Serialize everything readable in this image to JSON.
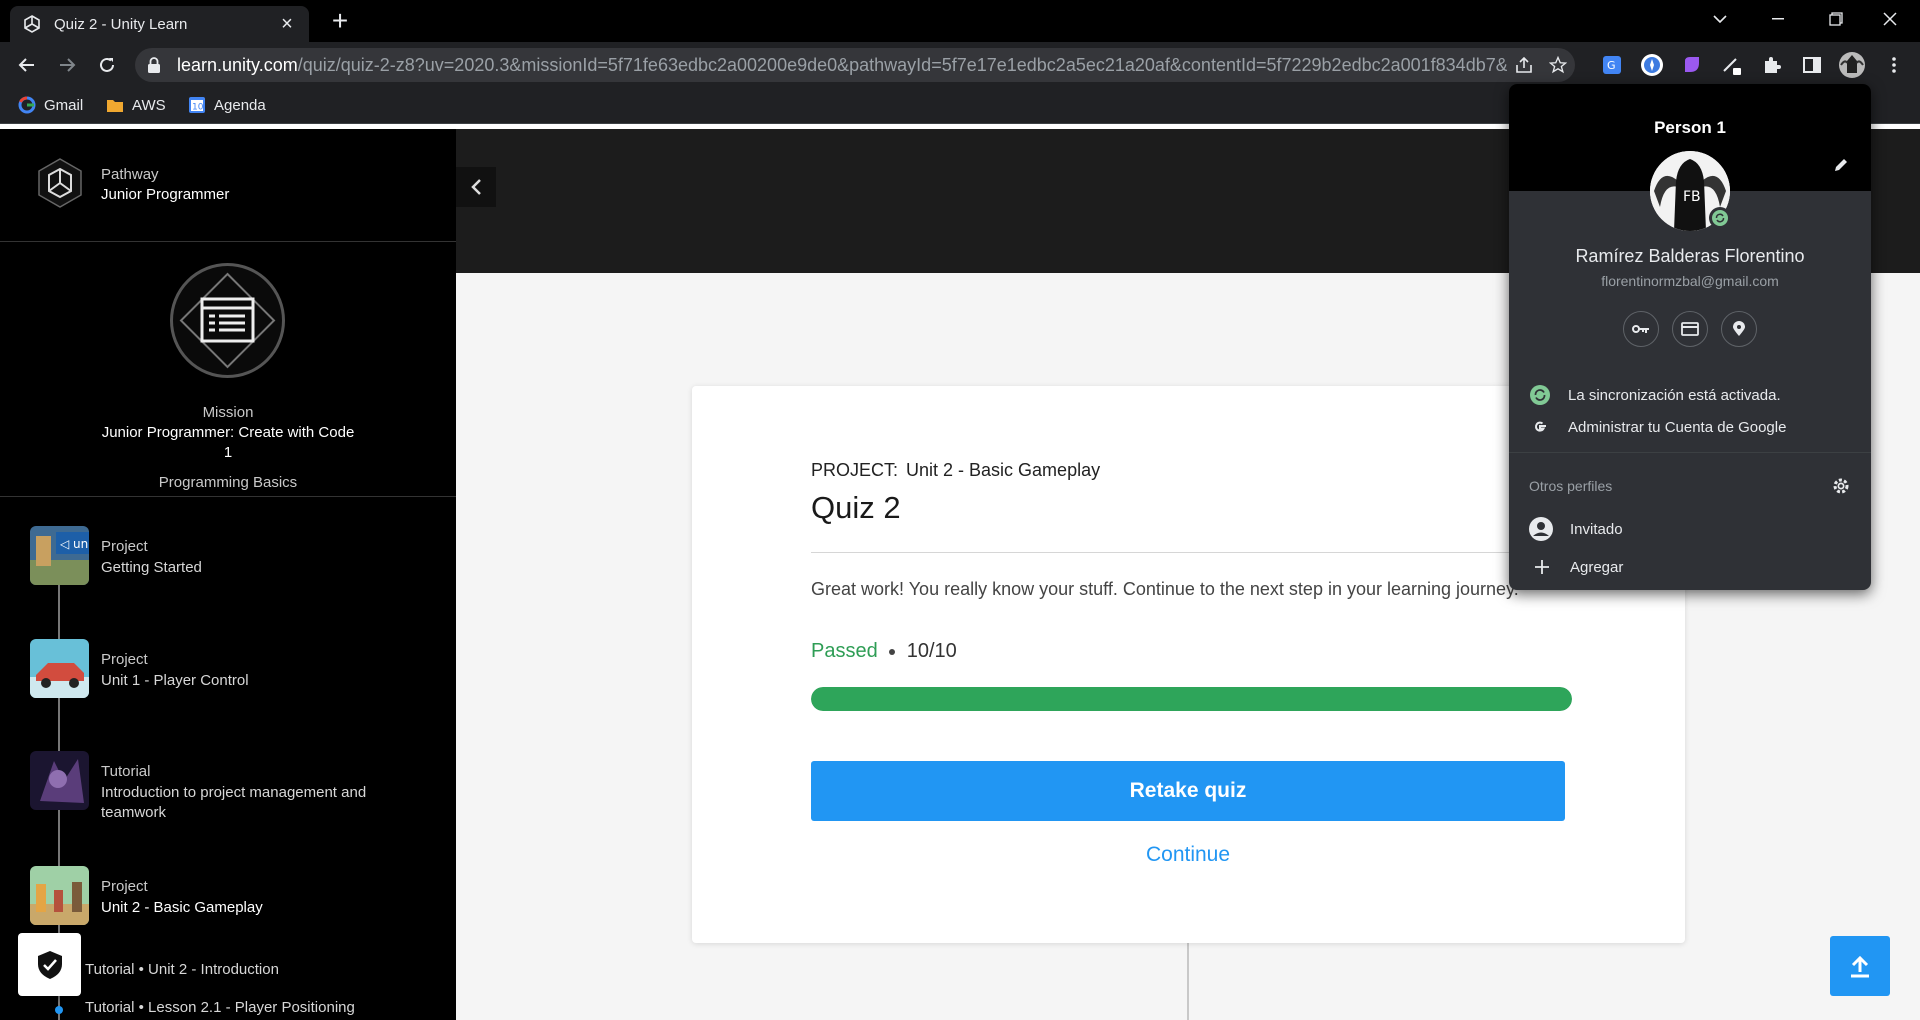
{
  "browser": {
    "tab_title": "Quiz 2 - Unity Learn",
    "url_host": "learn.unity.com",
    "url_path": "/quiz/quiz-2-z8?uv=2020.3&missionId=5f71fe63edbc2a00200e9de0&pathwayId=5f7e17e1edbc2a5ec21a20af&contentId=5f7229b2edbc2a001f834db7&...",
    "bookmarks": [
      {
        "label": "Gmail",
        "icon": "google-icon"
      },
      {
        "label": "AWS",
        "icon": "aws-folder-icon"
      },
      {
        "label": "Agenda",
        "icon": "calendar-icon",
        "badge": "10"
      }
    ]
  },
  "sidebar": {
    "pathway_kicker": "Pathway",
    "pathway_name": "Junior Programmer",
    "mission_kicker": "Mission",
    "mission_name": "Junior Programmer: Create with Code 1",
    "mission_sub": "Programming Basics",
    "steps": [
      {
        "kind": "Project",
        "label": "Getting Started"
      },
      {
        "kind": "Project",
        "label": "Unit 1 - Player Control"
      },
      {
        "kind": "Tutorial",
        "label": "Introduction to project management and teamwork"
      },
      {
        "kind": "Project",
        "label": "Unit 2 - Basic Gameplay"
      }
    ],
    "subitems": [
      "Tutorial • Unit 2 - Introduction",
      "Tutorial • Lesson 2.1 - Player Positioning"
    ]
  },
  "quiz": {
    "project_prefix": "PROJECT:",
    "project_name": "Unit 2 - Basic Gameplay",
    "title": "Quiz 2",
    "message": "Great work! You really know your stuff. Continue to the next step in your learning journey.",
    "status": "Passed",
    "score": "10/10",
    "progress_fraction": 1.0,
    "retake_label": "Retake quiz",
    "continue_label": "Continue"
  },
  "profile": {
    "header_name": "Person 1",
    "full_name": "Ramírez Balderas Florentino",
    "email": "florentinormzbal@gmail.com",
    "sync_status": "La sincronización está activada.",
    "manage_account": "Administrar tu Cuenta de Google",
    "other_profiles": "Otros perfiles",
    "guest": "Invitado",
    "add": "Agregar"
  },
  "colors": {
    "accent": "#2196f3",
    "passed": "#2e9d55",
    "progress": "#2ea55a",
    "sidebar_bg": "#000000",
    "chrome_bg": "#202124"
  }
}
